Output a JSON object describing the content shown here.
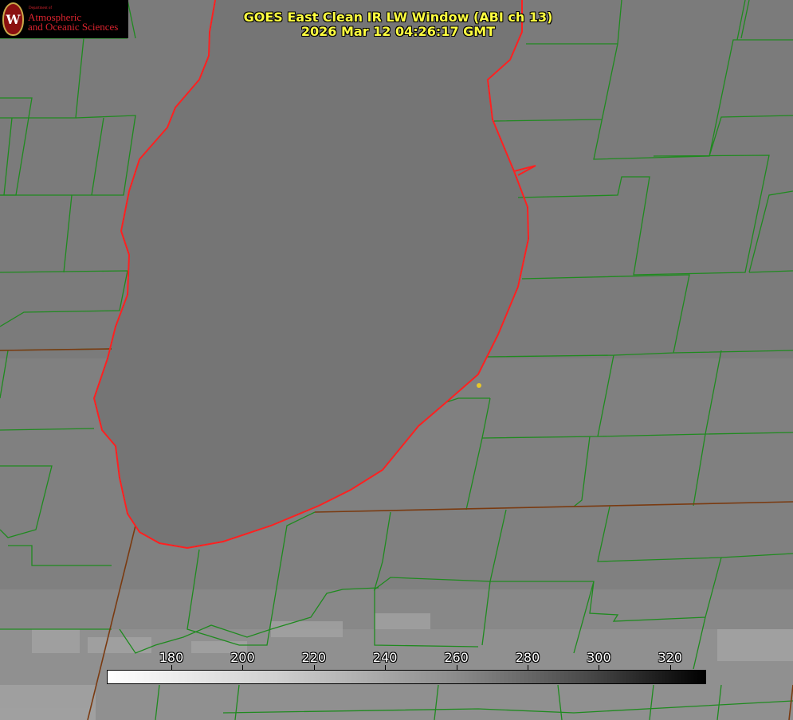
{
  "header": {
    "title": "GOES East Clean IR LW Window (ABI ch 13)",
    "timestamp": "2026 Mar 12 04:26:17 GMT"
  },
  "logo": {
    "dept": "Department of",
    "line1": "Atmospheric",
    "line2": "and Oceanic Sciences",
    "seal_letter": "W"
  },
  "colorbar": {
    "ticks": [
      "180",
      "200",
      "220",
      "240",
      "260",
      "280",
      "300",
      "320"
    ],
    "colors": {
      "low": "#ffffff",
      "high": "#000000"
    }
  },
  "colors": {
    "county_lines": "#1f8a1f",
    "state_lines": "#7a3a10",
    "lake_shore": "#ff2020",
    "marker": "#e6c62a",
    "lake_fill": "#757575",
    "land_fill": "#7c7c7c"
  }
}
